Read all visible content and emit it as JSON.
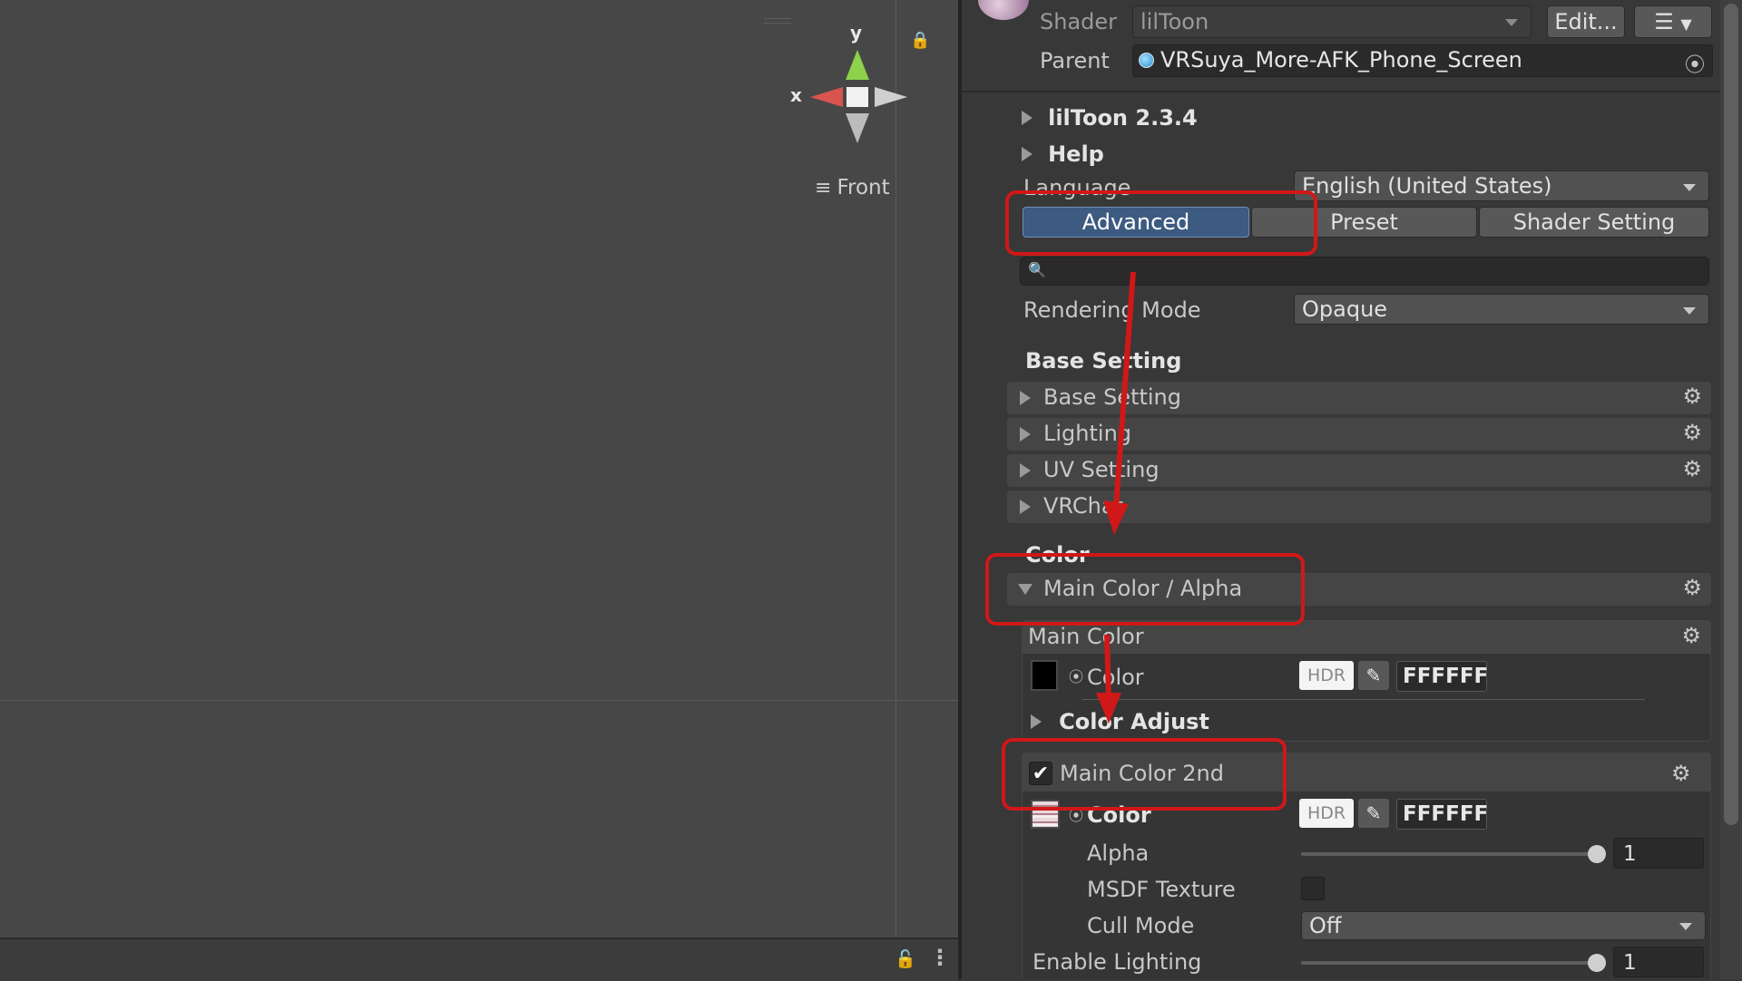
{
  "scene": {
    "gizmo": {
      "y_label": "y",
      "x_label": "x",
      "view_label": "Front"
    }
  },
  "inspector": {
    "shader": {
      "label": "Shader",
      "value": "lilToon",
      "edit_label": "Edit..."
    },
    "parent": {
      "label": "Parent",
      "value": "VRSuya_More-AFK_Phone_Screen"
    },
    "version_label": "lilToon 2.3.4",
    "help_label": "Help",
    "language": {
      "label": "Language",
      "value": "English (United States)"
    },
    "tabs": [
      {
        "label": "Advanced",
        "active": true
      },
      {
        "label": "Preset",
        "active": false
      },
      {
        "label": "Shader Setting",
        "active": false
      }
    ],
    "search": {
      "placeholder": ""
    },
    "rendering_mode": {
      "label": "Rendering Mode",
      "value": "Opaque"
    },
    "base_setting_header": "Base Setting",
    "base_foldouts": [
      "Base Setting",
      "Lighting",
      "UV Setting",
      "VRChat"
    ],
    "color_header": "Color",
    "main_color_alpha": {
      "label": "Main Color / Alpha",
      "main_color": {
        "title": "Main Color",
        "color_label": "Color",
        "hdr": "HDR",
        "hex": "FFFFFF",
        "swatch": "#000000"
      },
      "color_adjust_label": "Color Adjust"
    },
    "main_color_2nd": {
      "label": "Main Color 2nd",
      "checked": true,
      "color_label": "Color",
      "hdr": "HDR",
      "hex": "FFFFFF",
      "alpha": {
        "label": "Alpha",
        "value": "1",
        "level": 1.0
      },
      "msdf": {
        "label": "MSDF Texture",
        "checked": false
      },
      "cull_mode": {
        "label": "Cull Mode",
        "value": "Off"
      },
      "enable_lighting": {
        "label": "Enable Lighting",
        "value": "1",
        "level": 1.0
      }
    }
  },
  "colors": {
    "annotation_red": "#d01818",
    "active_tab": "#3d5a80",
    "axis_x": "#d9534f",
    "axis_y": "#8ed14a"
  }
}
